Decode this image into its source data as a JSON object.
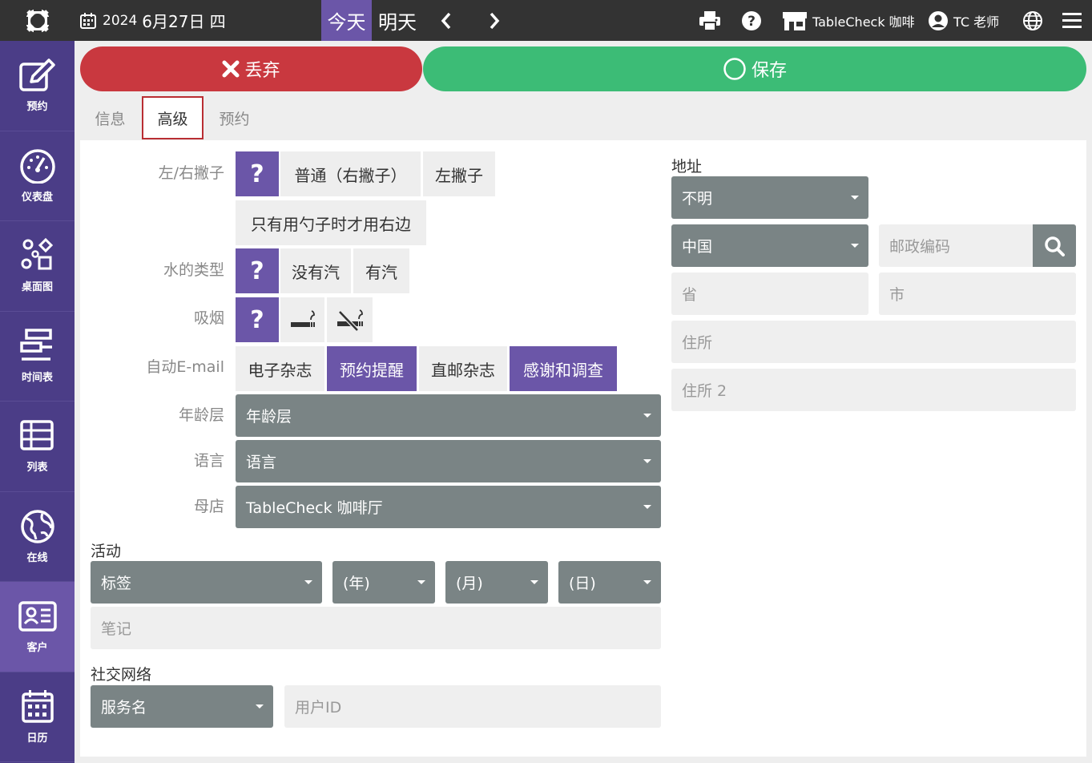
{
  "topbar": {
    "date_year": "2024",
    "date_rest": "6月27日 四",
    "today": "今天",
    "tomorrow": "明天",
    "store_name": "TableCheck 咖啡",
    "user_name": "TC 老师"
  },
  "sidebar": {
    "items": [
      {
        "label": "预约"
      },
      {
        "label": "仪表盘"
      },
      {
        "label": "桌面图"
      },
      {
        "label": "时间表"
      },
      {
        "label": "列表"
      },
      {
        "label": "在线"
      },
      {
        "label": "客户"
      },
      {
        "label": "日历"
      }
    ]
  },
  "actions": {
    "discard": "丢弃",
    "save": "保存"
  },
  "tabs": [
    {
      "label": "信息"
    },
    {
      "label": "高级"
    },
    {
      "label": "预约"
    }
  ],
  "form": {
    "handedness": {
      "label": "左/右撇子",
      "unknown": "?",
      "normal": "普通（右撇子）",
      "left": "左撇子",
      "spoon_only": "只有用勺子时才用右边"
    },
    "water": {
      "label": "水的类型",
      "unknown": "?",
      "still": "没有汽",
      "sparkling": "有汽"
    },
    "smoking": {
      "label": "吸烟",
      "unknown": "?"
    },
    "email": {
      "label": "自动E-mail",
      "options": [
        "电子杂志",
        "预约提醒",
        "直邮杂志",
        "感谢和调查"
      ]
    },
    "age": {
      "label": "年龄层",
      "value": "年龄层"
    },
    "language": {
      "label": "语言",
      "value": "语言"
    },
    "home_store": {
      "label": "母店",
      "value": "TableCheck 咖啡厅"
    },
    "activity": {
      "title": "活动",
      "tag": "标签",
      "year": "(年)",
      "month": "(月)",
      "day": "(日)",
      "notes_placeholder": "笔记"
    },
    "social": {
      "title": "社交网络",
      "service": "服务名",
      "user_id_placeholder": "用户ID"
    },
    "address": {
      "title": "地址",
      "type": "不明",
      "country": "中国",
      "postal_placeholder": "邮政编码",
      "province_placeholder": "省",
      "city_placeholder": "市",
      "address1_placeholder": "住所",
      "address2_placeholder": "住所 2"
    }
  },
  "colors": {
    "topbar": "#333333",
    "sidebar": "#4b3d87",
    "accent": "#6b56a8",
    "discard": "#c9383f",
    "save": "#3cbc76",
    "select": "#7a8485"
  }
}
